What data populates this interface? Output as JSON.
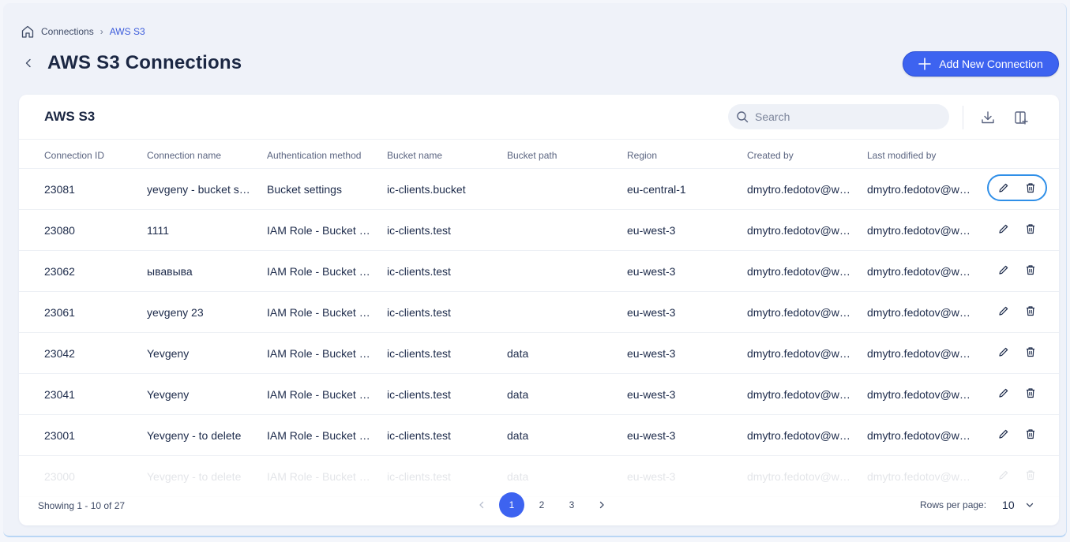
{
  "breadcrumb": {
    "items": [
      "Connections"
    ],
    "current": "AWS S3"
  },
  "page": {
    "title": "AWS S3 Connections",
    "add_button_label": "Add New Connection"
  },
  "card": {
    "title": "AWS S3",
    "search_placeholder": "Search"
  },
  "columns": [
    "Connection ID",
    "Connection name",
    "Authentication method",
    "Bucket name",
    "Bucket path",
    "Region",
    "Created by",
    "Last modified by"
  ],
  "rows": [
    {
      "id": "23081",
      "name": "yevgeny - bucket se...",
      "auth": "Bucket settings",
      "bucket": "ic-clients.bucket",
      "path": "",
      "region": "eu-central-1",
      "created_by": "dmytro.fedotov@wal...",
      "modified_by": "dmytro.fedotov@wal..."
    },
    {
      "id": "23080",
      "name": "1111",
      "auth": "IAM Role - Bucket o...",
      "bucket": "ic-clients.test",
      "path": "",
      "region": "eu-west-3",
      "created_by": "dmytro.fedotov@wal...",
      "modified_by": "dmytro.fedotov@wal..."
    },
    {
      "id": "23062",
      "name": "ывавыва",
      "auth": "IAM Role - Bucket o...",
      "bucket": "ic-clients.test",
      "path": "",
      "region": "eu-west-3",
      "created_by": "dmytro.fedotov@wal...",
      "modified_by": "dmytro.fedotov@wal..."
    },
    {
      "id": "23061",
      "name": "yevgeny 23",
      "auth": "IAM Role - Bucket o...",
      "bucket": "ic-clients.test",
      "path": "",
      "region": "eu-west-3",
      "created_by": "dmytro.fedotov@wal...",
      "modified_by": "dmytro.fedotov@wal..."
    },
    {
      "id": "23042",
      "name": "Yevgeny",
      "auth": "IAM Role - Bucket o...",
      "bucket": "ic-clients.test",
      "path": "data",
      "region": "eu-west-3",
      "created_by": "dmytro.fedotov@wal...",
      "modified_by": "dmytro.fedotov@wal..."
    },
    {
      "id": "23041",
      "name": "Yevgeny",
      "auth": "IAM Role - Bucket o...",
      "bucket": "ic-clients.test",
      "path": "data",
      "region": "eu-west-3",
      "created_by": "dmytro.fedotov@wal...",
      "modified_by": "dmytro.fedotov@wal..."
    },
    {
      "id": "23001",
      "name": "Yevgeny - to delete",
      "auth": "IAM Role - Bucket o...",
      "bucket": "ic-clients.test",
      "path": "data",
      "region": "eu-west-3",
      "created_by": "dmytro.fedotov@wal...",
      "modified_by": "dmytro.fedotov@wal..."
    },
    {
      "id": "23000",
      "name": "Yevgeny - to delete",
      "auth": "IAM Role - Bucket o...",
      "bucket": "ic-clients.test",
      "path": "data",
      "region": "eu-west-3",
      "created_by": "dmytro.fedotov@wal...",
      "modified_by": "dmytro.fedotov@wal..."
    }
  ],
  "footer": {
    "showing": "Showing 1 - 10 of 27",
    "pages": [
      "1",
      "2",
      "3"
    ],
    "active_page": "1",
    "prev_icon": "chevron-left-icon",
    "next_icon": "chevron-right-icon",
    "rows_per_page_label": "Rows per page:",
    "rows_per_page_value": "10"
  },
  "colors": {
    "accent": "#3d63f0",
    "focus_ring": "#2f8fe8",
    "title": "#1b2743"
  }
}
